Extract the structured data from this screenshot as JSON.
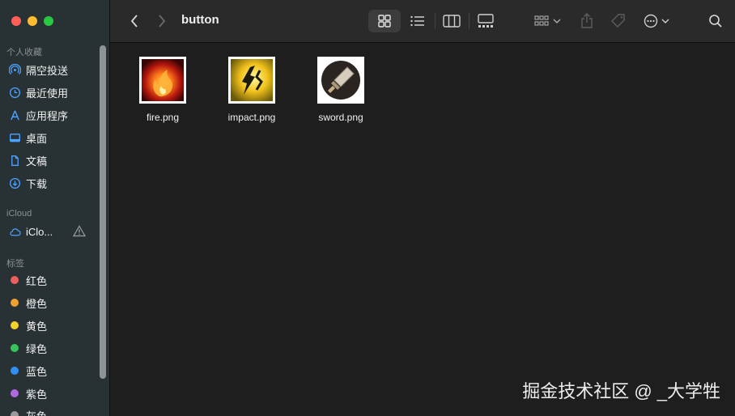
{
  "window": {
    "title": "button"
  },
  "sidebar": {
    "favorites_title": "个人收藏",
    "favorites": [
      {
        "label": "隔空投送",
        "icon": "airdrop-icon"
      },
      {
        "label": "最近使用",
        "icon": "clock-icon"
      },
      {
        "label": "应用程序",
        "icon": "applications-icon"
      },
      {
        "label": "桌面",
        "icon": "desktop-icon"
      },
      {
        "label": "文稿",
        "icon": "document-icon"
      },
      {
        "label": "下载",
        "icon": "download-icon"
      }
    ],
    "icloud_title": "iCloud",
    "icloud_item": {
      "label": "iClo...",
      "icon": "cloud-icon"
    },
    "tags_title": "标签",
    "tags": [
      {
        "label": "红色",
        "color": "#ec5f5f"
      },
      {
        "label": "橙色",
        "color": "#f0a030"
      },
      {
        "label": "黄色",
        "color": "#f5d22a"
      },
      {
        "label": "绿色",
        "color": "#36c35a"
      },
      {
        "label": "蓝色",
        "color": "#2f8ff2"
      },
      {
        "label": "紫色",
        "color": "#b168e0"
      },
      {
        "label": "灰色",
        "color": "#9a9a9a"
      }
    ]
  },
  "files": [
    {
      "name": "fire.png",
      "icon": "fire-image"
    },
    {
      "name": "impact.png",
      "icon": "impact-image"
    },
    {
      "name": "sword.png",
      "icon": "sword-image"
    }
  ],
  "watermark": "掘金技术社区 @ _大学牲"
}
